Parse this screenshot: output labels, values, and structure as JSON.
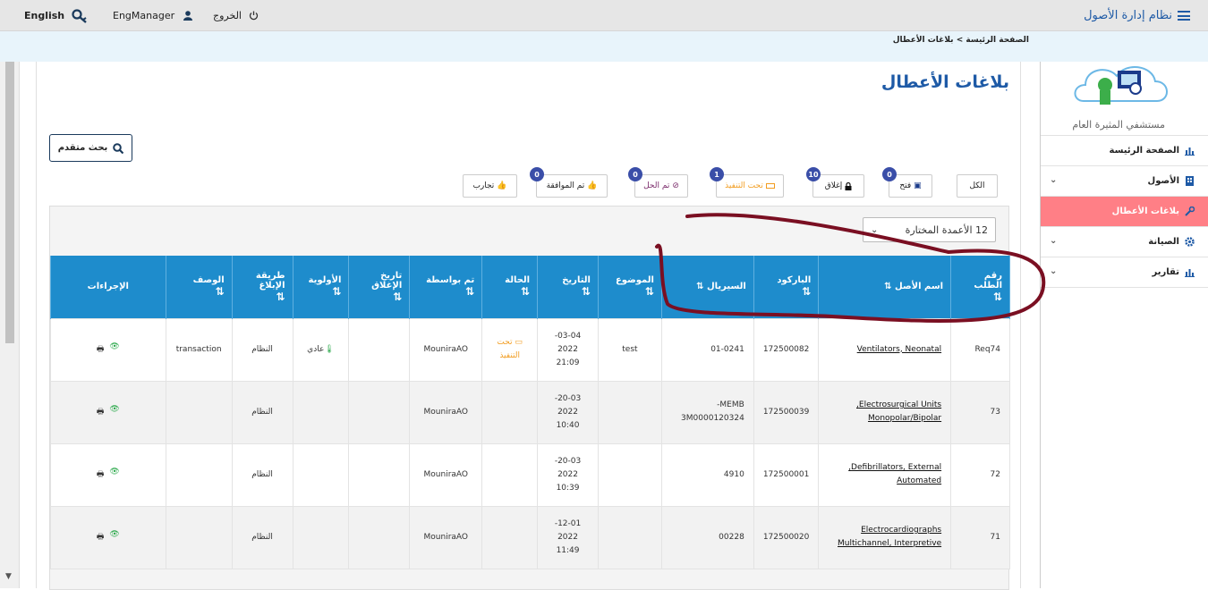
{
  "topbar": {
    "language": "English",
    "user": "EngManager",
    "logout": "الخروج",
    "app_title": "نظام إدارة الأصول"
  },
  "breadcrumb": {
    "home": "الصفحة الرئيسة",
    "sep": ">",
    "current": "بلاغات الأعطال"
  },
  "sidebar": {
    "hospital": "مستشفي المثيرة العام",
    "items": [
      {
        "label": "الصفحة الرئيسة",
        "has_chevron": false
      },
      {
        "label": "الأصول",
        "has_chevron": true
      },
      {
        "label": "بلاغات الأعطال",
        "has_chevron": false
      },
      {
        "label": "الصيانة",
        "has_chevron": true
      },
      {
        "label": "تقارير",
        "has_chevron": true
      }
    ],
    "active_color": "#ff7f86"
  },
  "page": {
    "title": "بلاغات الأعطال",
    "advanced_search": "بحث متقدم"
  },
  "filters": [
    {
      "label": "الكل",
      "count": ""
    },
    {
      "label": "فتح",
      "count": "0"
    },
    {
      "label": "إغلاق",
      "count": "10"
    },
    {
      "label": "تحت التنفيذ",
      "count": "1"
    },
    {
      "label": "تم الحل",
      "count": "0"
    },
    {
      "label": "تم الموافقة",
      "count": "0"
    },
    {
      "label": "تجارب",
      "count": ""
    }
  ],
  "column_selector": "12 الأعمدة المختارة",
  "table": {
    "headers": [
      "رقم الطلب",
      "اسم الأصل",
      "الباركود",
      "السيريال",
      "الموضوع",
      "التاريخ",
      "الحالة",
      "تم بواسطة",
      "تاريخ الإغلاق",
      "الأولوية",
      "طريقة الإبلاغ",
      "الوصف",
      "الإجراءات"
    ],
    "rows": [
      {
        "req": "Req74",
        "asset1": "Ventilators, Neonatal",
        "asset2": "",
        "barcode": "172500082",
        "serial1": "01-0241",
        "serial2": "",
        "subject": "test",
        "date1": "03-04-",
        "date2": "2022",
        "date3": "21:09",
        "status1": "تحت",
        "status2": "التنفيذ",
        "by": "MounirаAO",
        "closed": "",
        "priority": "عادي",
        "method": "النظام",
        "desc": "transaction"
      },
      {
        "req": "73",
        "asset1": "Electrosurgical Units,",
        "asset2": "Monopolar/Bipolar",
        "barcode": "172500039",
        "serial1": "MEMB-",
        "serial2": "3M0000120324",
        "subject": "",
        "date1": "20-03-",
        "date2": "2022",
        "date3": "10:40",
        "status1": "",
        "status2": "",
        "by": "MounirаAO",
        "closed": "",
        "priority": "",
        "method": "النظام",
        "desc": ""
      },
      {
        "req": "72",
        "asset1": "Defibrillators, External,",
        "asset2": "Automated",
        "barcode": "172500001",
        "serial1": "4910",
        "serial2": "",
        "subject": "",
        "date1": "20-03-",
        "date2": "2022",
        "date3": "10:39",
        "status1": "",
        "status2": "",
        "by": "MounirаAO",
        "closed": "",
        "priority": "",
        "method": "النظام",
        "desc": ""
      },
      {
        "req": "71",
        "asset1": "Electrocardiographs",
        "asset2": "Multichannel, Interpretive",
        "barcode": "172500020",
        "serial1": "00228",
        "serial2": "",
        "subject": "",
        "date1": "12-01-",
        "date2": "2022",
        "date3": "11:49",
        "status1": "",
        "status2": "",
        "by": "MounirаAO",
        "closed": "",
        "priority": "",
        "method": "النظام",
        "desc": ""
      }
    ]
  },
  "colors": {
    "header_blue": "#1e8ccc",
    "title_blue": "#1e5aa6",
    "badge": "#3a4ea8",
    "annotation": "#7a0f22"
  }
}
